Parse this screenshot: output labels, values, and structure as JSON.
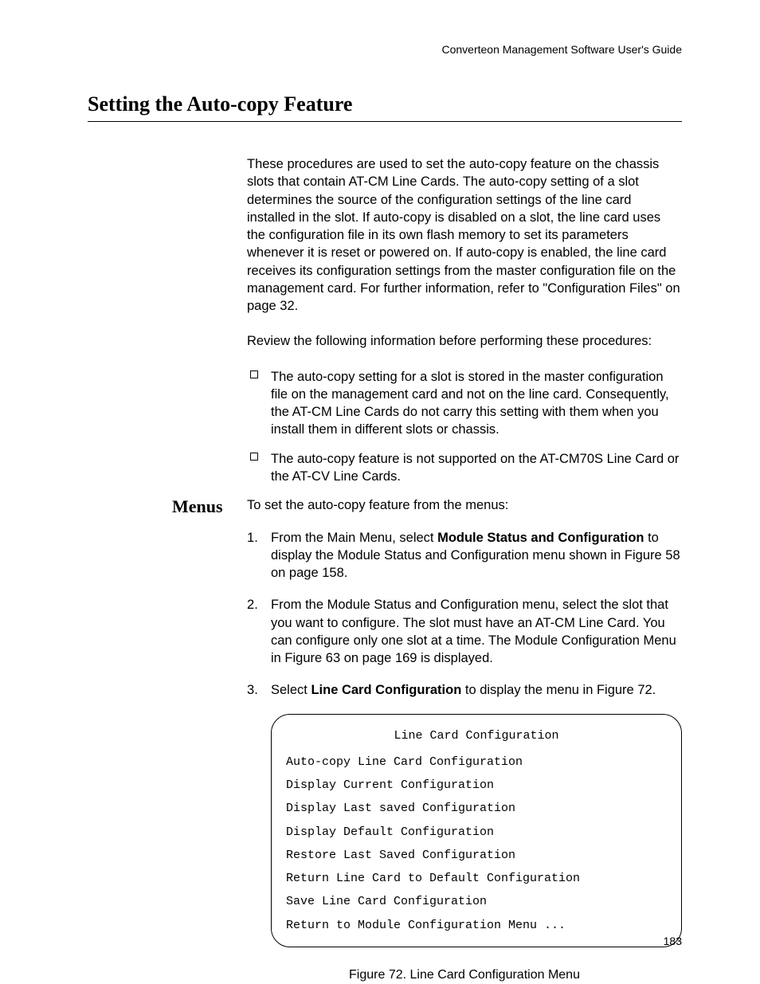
{
  "header": {
    "guide_title": "Converteon Management Software User's Guide"
  },
  "section": {
    "title": "Setting the Auto-copy Feature"
  },
  "intro_para": "These procedures are used to set the auto-copy feature on the chassis slots that contain AT-CM Line Cards. The auto-copy setting of a slot determines the source of the configuration settings of the line card installed in the slot. If auto-copy is disabled on a slot, the line card uses the configuration file in its own flash memory to set its parameters whenever it is reset or powered on. If auto-copy is enabled, the line card receives its configuration settings from the master configuration file on the management card. For further information, refer to \"Configuration Files\" on page 32.",
  "review_line": "Review the following information before performing these procedures:",
  "bullets": [
    "The auto-copy setting for a slot is stored in the master configuration file on the management card and not on the line card. Consequently, the AT-CM Line Cards do not carry this setting with them when you install them in different slots or chassis.",
    "The auto-copy feature is not supported on the AT-CM70S Line Card or the AT-CV Line Cards."
  ],
  "menus": {
    "label": "Menus",
    "lead": "To set the auto-copy feature from the menus:",
    "steps": {
      "s1_a": "From the Main Menu, select ",
      "s1_bold": "Module Status and Configuration",
      "s1_b": " to display the Module Status and Configuration menu shown in Figure 58 on page 158.",
      "s2": "From the Module Status and Configuration menu, select the slot that you want to configure. The slot must have an AT-CM Line Card. You can configure only one slot at a time. The Module Configuration Menu in Figure 63 on page 169 is displayed.",
      "s3_a": "Select ",
      "s3_bold": "Line Card Configuration",
      "s3_b": " to display the menu in Figure 72."
    }
  },
  "menu_box": {
    "title": "Line Card Configuration",
    "items": [
      "Auto-copy Line Card Configuration",
      "Display Current Configuration",
      "Display Last saved Configuration",
      "Display Default Configuration",
      "Restore Last Saved Configuration",
      "Return Line Card to Default Configuration",
      "Save Line Card Configuration",
      "Return to Module Configuration Menu ..."
    ]
  },
  "figure_caption": "Figure 72. Line Card Configuration Menu",
  "page_number": "183"
}
